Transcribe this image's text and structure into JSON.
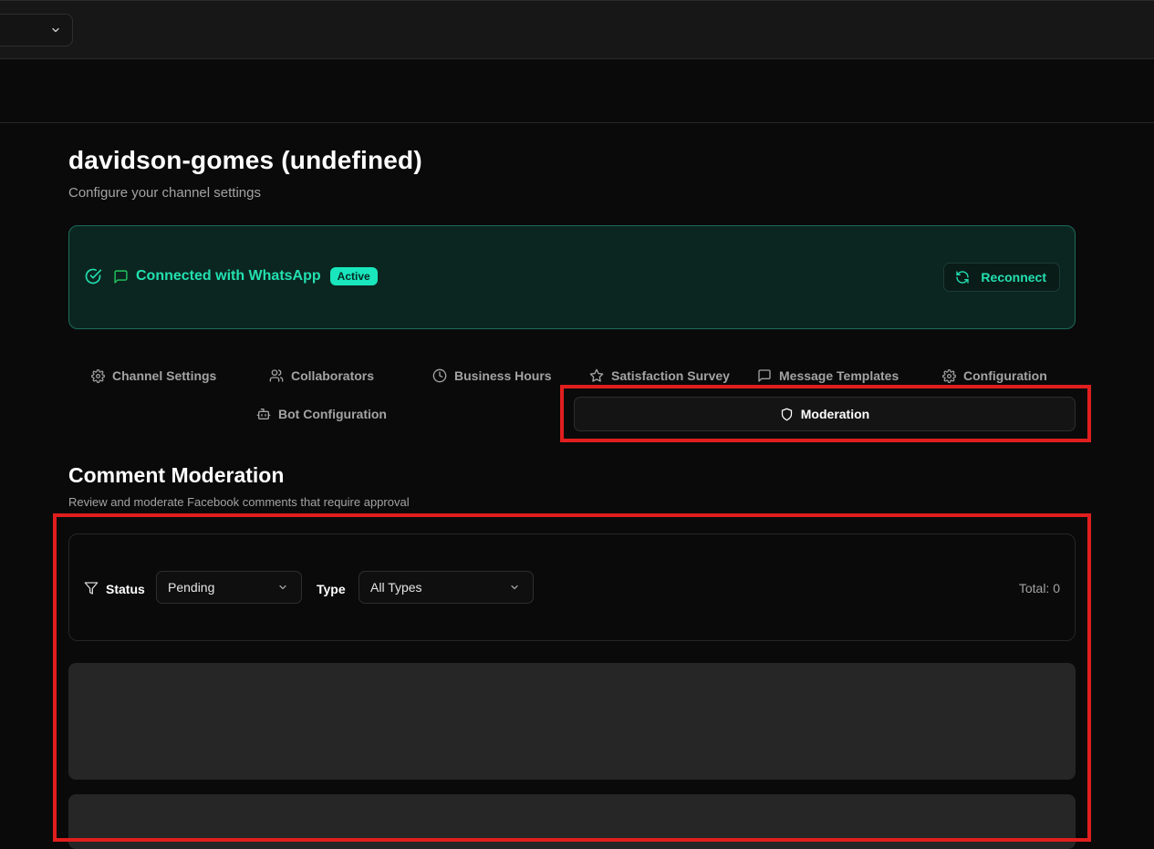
{
  "header": {
    "title": "davidson-gomes (undefined)",
    "subtitle": "Configure your channel settings"
  },
  "connection": {
    "label": "Connected with WhatsApp",
    "badge": "Active",
    "reconnect_label": "Reconnect",
    "accent_color": "#22e0b0"
  },
  "tabs": [
    {
      "label": "Channel Settings",
      "icon": "gear-icon"
    },
    {
      "label": "Collaborators",
      "icon": "users-icon"
    },
    {
      "label": "Business Hours",
      "icon": "clock-icon"
    },
    {
      "label": "Satisfaction Survey",
      "icon": "star-icon"
    },
    {
      "label": "Message Templates",
      "icon": "message-icon"
    },
    {
      "label": "Configuration",
      "icon": "gear-icon"
    },
    {
      "label": "Bot Configuration",
      "icon": "bot-icon"
    },
    {
      "label": "Moderation",
      "icon": "shield-icon",
      "active": true
    }
  ],
  "moderation": {
    "title": "Comment Moderation",
    "subtitle": "Review and moderate Facebook comments that require approval",
    "filters": {
      "status_label": "Status",
      "status_value": "Pending",
      "type_label": "Type",
      "type_value": "All Types",
      "total": "Total: 0"
    }
  },
  "highlight_color": "#e01e1e"
}
